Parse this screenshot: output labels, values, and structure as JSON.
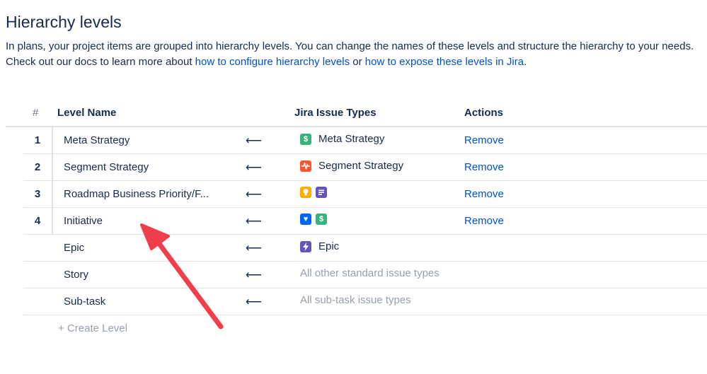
{
  "header": {
    "title": "Hierarchy levels",
    "desc_line1": "In plans, your project items are grouped into hierarchy levels. You can change the names of these levels and structure the hierarchy to your needs.",
    "desc_prefix": "Check out our docs to learn more about ",
    "link1": "how to configure hierarchy levels",
    "desc_or": " or ",
    "link2": "how to expose these levels in Jira",
    "desc_suffix": "."
  },
  "table": {
    "headers": {
      "num": "#",
      "name": "Level Name",
      "types": "Jira Issue Types",
      "actions": "Actions"
    },
    "arrow": "⟵",
    "rows": [
      {
        "num": "1",
        "name": "Meta Strategy",
        "type_label": "Meta Strategy",
        "action": "Remove"
      },
      {
        "num": "2",
        "name": "Segment Strategy",
        "type_label": "Segment Strategy",
        "action": "Remove"
      },
      {
        "num": "3",
        "name": "Roadmap Business Priority/F...",
        "action": "Remove"
      },
      {
        "num": "4",
        "name": "Initiative",
        "action": "Remove"
      },
      {
        "name": "Epic",
        "type_label": "Epic"
      },
      {
        "name": "Story",
        "type_text": "All other standard issue types"
      },
      {
        "name": "Sub-task",
        "type_text": "All sub-task issue types"
      }
    ],
    "create_label": "+ Create Level"
  },
  "icons": {
    "dollar": {
      "name": "dollar-icon",
      "color": "#36b37e",
      "glyph": "$"
    },
    "pulse": {
      "name": "pulse-icon",
      "color": "#ff5630",
      "glyph": "~"
    },
    "bulb": {
      "name": "lightbulb-icon",
      "color": "#ffab00",
      "glyph": "●"
    },
    "doc": {
      "name": "document-icon",
      "color": "#6554c0",
      "glyph": "≡"
    },
    "heart": {
      "name": "heart-icon",
      "color": "#0065ff",
      "glyph": "♥"
    },
    "bolt": {
      "name": "lightning-icon",
      "color": "#6554c0",
      "glyph": "ϟ"
    }
  },
  "colors": {
    "link": "#0052cc",
    "text": "#172b4d",
    "muted": "#97a0af",
    "annotation_arrow": "#f03e4a"
  }
}
